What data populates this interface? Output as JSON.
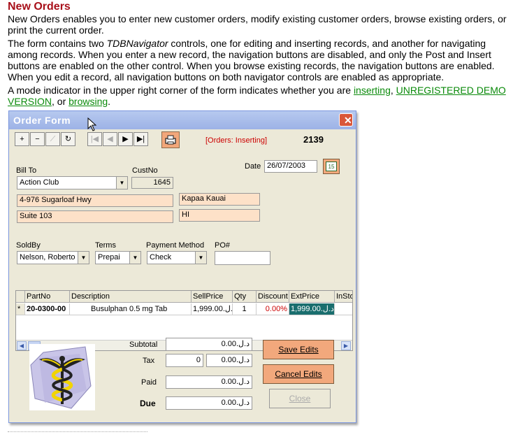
{
  "doc": {
    "heading": "New Orders",
    "p1": "New Orders enables you to enter new customer orders, modify existing customer orders, browse existing orders, or print the current order.",
    "p2_before": "The form contains two ",
    "p2_italic": "TDBNavigator",
    "p2_after": " controls, one for editing and inserting records, and another for navigating among records. When you enter a new record, the navigation buttons are disabled, and only the Post and Insert buttons are enabled on the other control. When you browse existing records, the navigation buttons are enabled. When you edit a record, all navigation buttons on both navigator controls are enabled as appropriate.",
    "p3_before": "A mode indicator in the upper right corner of the form indicates whether you are ",
    "link_inserting": "inserting",
    "sep1": ", ",
    "link_unregistered": "UNREGISTERED DEMO VERSION",
    "sep2": ", or ",
    "link_browsing": "browsing",
    "p3_end": "."
  },
  "window": {
    "title": "Order Form",
    "close_glyph": "✕"
  },
  "toolbar": {
    "insert": "+",
    "delete": "−",
    "edit": "⟋",
    "refresh": "↻",
    "first": "|◀",
    "prior": "◀",
    "next": "▶",
    "last": "▶|",
    "mode_text": "[Orders: Inserting]",
    "order_no": "2139"
  },
  "bill_to": {
    "label": "Bill To",
    "custno_label": "CustNo",
    "company": "Action Club",
    "custno": "1645",
    "addr1": "4-976 Sugarloaf Hwy",
    "addr2": "Suite 103",
    "city": "Kapaa Kauai",
    "state": "HI"
  },
  "date": {
    "label": "Date",
    "value": "26/07/2003",
    "calendar_glyph": "15"
  },
  "selectors": {
    "soldby_label": "SoldBy",
    "soldby": "Nelson, Roberto",
    "terms_label": "Terms",
    "terms": "Prepai",
    "payment_label": "Payment Method",
    "payment": "Check",
    "po_label": "PO#",
    "po": ""
  },
  "grid": {
    "headers": [
      "PartNo",
      "Description",
      "SellPrice",
      "Qty",
      "Discount",
      "ExtPrice",
      "InSto"
    ],
    "row": {
      "marker": "*",
      "partno": "20-0300-00",
      "description": "Busulphan  0.5 mg  Tab",
      "sellprice": "د.ل.1,999.00",
      "qty": "1",
      "discount": "0.00%",
      "extprice": "د.ل.1,999.00"
    }
  },
  "totals": {
    "subtotal_label": "Subtotal",
    "subtotal": "د.ل.0.00",
    "tax_label": "Tax",
    "tax_rate": "0",
    "tax": "د.ل.0.00",
    "paid_label": "Paid",
    "paid": "د.ل.0.00",
    "due_label": "Due",
    "due": "د.ل.0.00"
  },
  "buttons": {
    "save": "Save Edits",
    "cancel": "Cancel Edits",
    "close": "Close"
  },
  "colors": {
    "heading": "#a8101a",
    "link": "#0a8a0a",
    "peach": "#fde1c8",
    "orange_button": "#f2a87c",
    "mode_text": "#cc0000"
  }
}
